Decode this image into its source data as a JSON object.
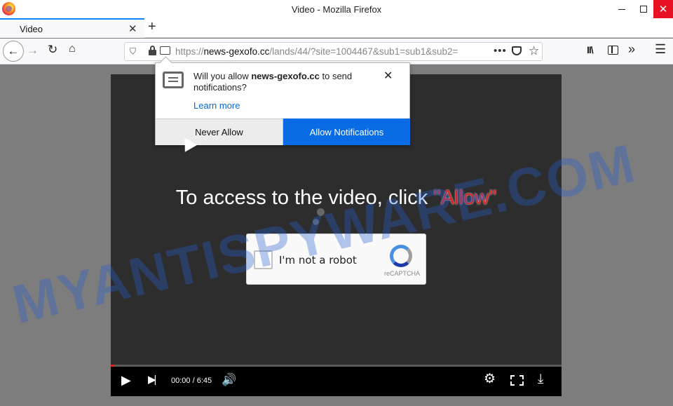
{
  "window": {
    "title": "Video - Mozilla Firefox",
    "minimize": "",
    "maximize": "",
    "close": "✕"
  },
  "tab": {
    "label": "Video",
    "close": "✕",
    "new_tab": "+"
  },
  "navbar": {
    "back": "←",
    "forward": "→",
    "reload": "↻",
    "home": "⌂",
    "url_scheme": "https://",
    "url_host": "news-gexofo.cc",
    "url_path": "/lands/44/?site=1004467&sub1=sub1&sub2=",
    "more": "•••",
    "star": "☆",
    "library": "II\\",
    "overflow": "»",
    "menu": "☰"
  },
  "popup": {
    "text_before": "Will you allow ",
    "host": "news-gexofo.cc",
    "text_after": " to send notifications?",
    "learn_more": "Learn more",
    "close": "✕",
    "never_allow": "Never Allow",
    "allow_notifications": "Allow Notifications"
  },
  "player": {
    "cta_text": "To access to the video, click ",
    "cta_allow": "\"Allow\"",
    "captcha_label": "I'm not a robot",
    "captcha_brand": "reCAPTCHA",
    "time": "00:00 / 6:45",
    "progress": 0.01,
    "play": "▶",
    "next": "▶|",
    "volume": "🔊",
    "settings": "⚙",
    "download": "⤓"
  },
  "watermark": "MYANTISPYWARE.COM"
}
